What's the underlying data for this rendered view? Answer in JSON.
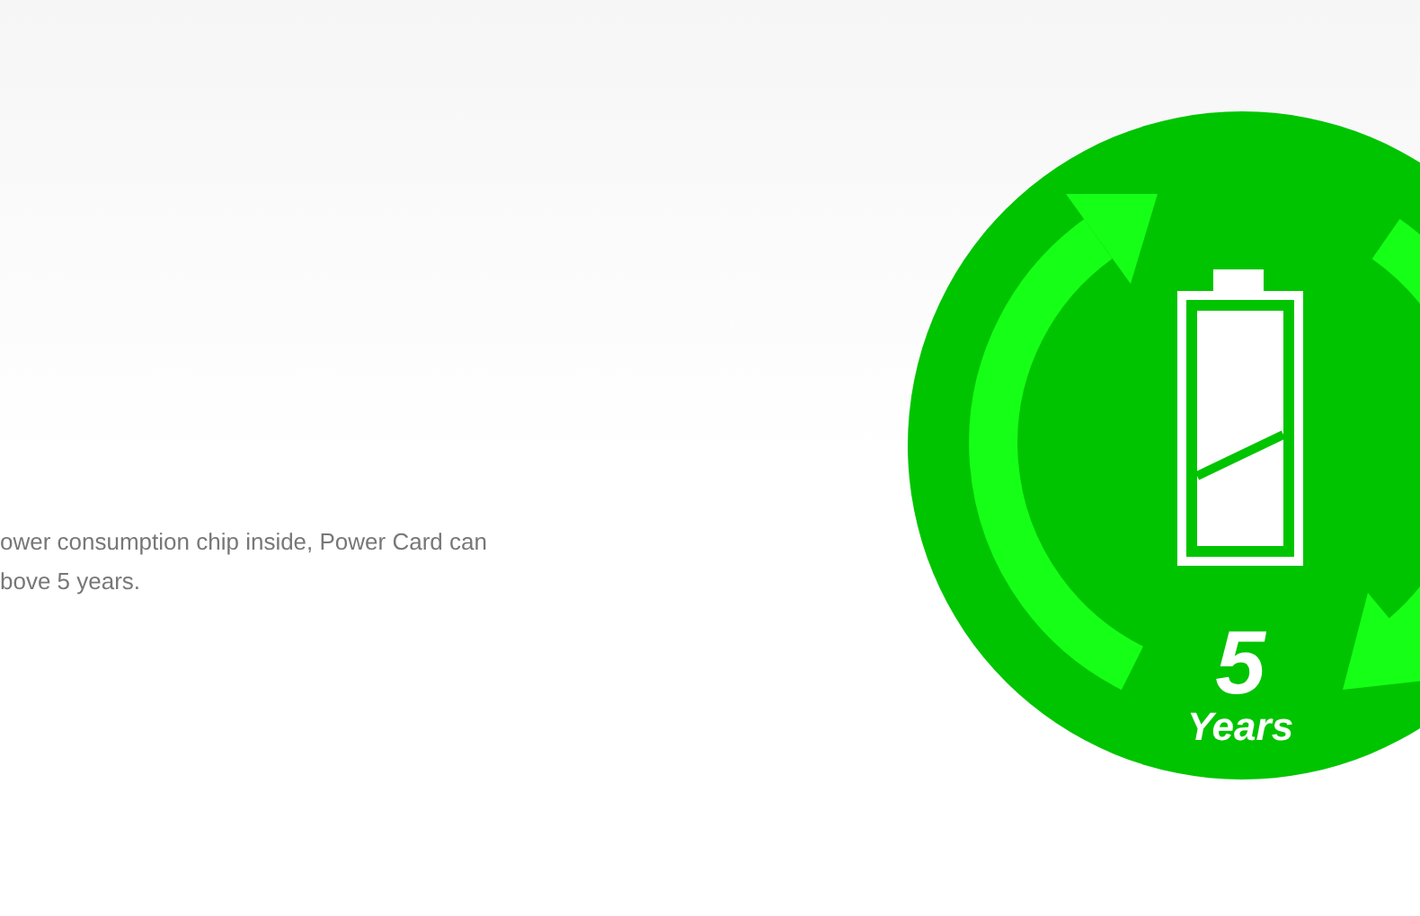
{
  "description": {
    "lines": [
      "ower consumption chip inside, Power Card can",
      "bove 5 years."
    ]
  },
  "badge": {
    "number": "5",
    "unit": "Years"
  }
}
